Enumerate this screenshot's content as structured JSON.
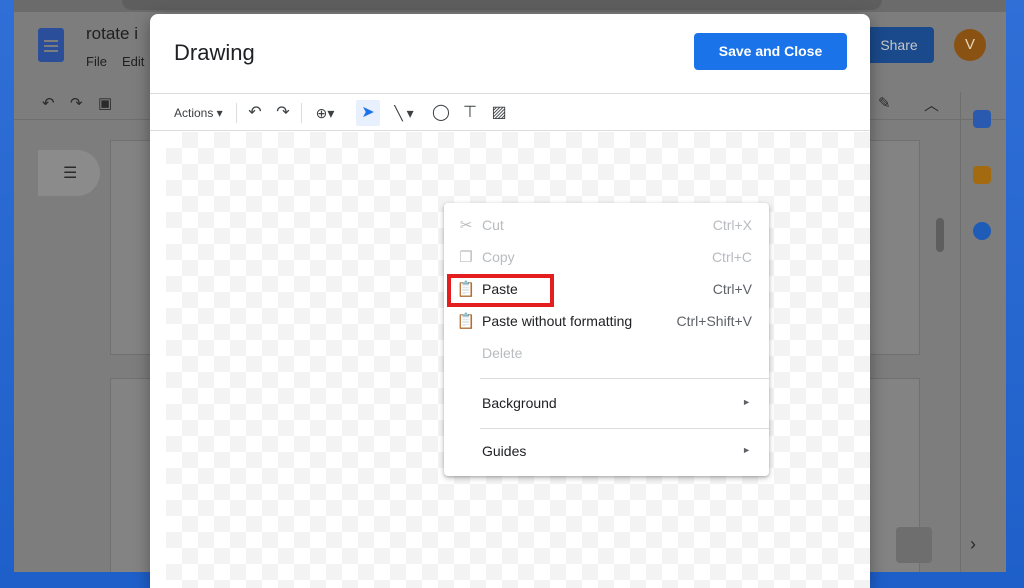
{
  "docs": {
    "title": "rotate i",
    "menu_file": "File",
    "menu_edit": "Edit",
    "share_label": "Share",
    "avatar_letter": "V"
  },
  "dialog": {
    "title": "Drawing",
    "save_close_label": "Save and Close",
    "toolbar": {
      "actions_label": "Actions ▾"
    }
  },
  "context_menu": {
    "items": [
      {
        "label": "Cut",
        "shortcut": "Ctrl+X",
        "icon": "scissors-icon",
        "enabled": false
      },
      {
        "label": "Copy",
        "shortcut": "Ctrl+C",
        "icon": "copy-icon",
        "enabled": false
      },
      {
        "label": "Paste",
        "shortcut": "Ctrl+V",
        "icon": "clipboard-icon",
        "enabled": true
      },
      {
        "label": "Paste without formatting",
        "shortcut": "Ctrl+Shift+V",
        "icon": "clipboard-text-icon",
        "enabled": true
      },
      {
        "label": "Delete",
        "shortcut": "",
        "icon": "",
        "enabled": false
      },
      {
        "label": "Background",
        "submenu": true,
        "enabled": true
      },
      {
        "label": "Guides",
        "submenu": true,
        "enabled": true
      }
    ]
  },
  "colors": {
    "accent": "#1a73e8",
    "highlight": "#e41e1e"
  }
}
